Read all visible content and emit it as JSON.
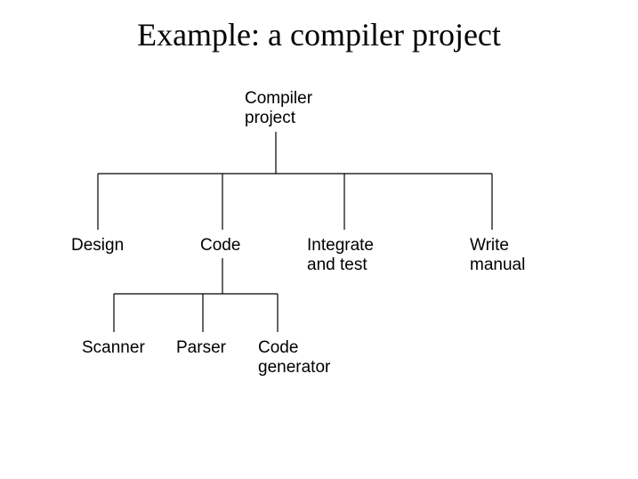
{
  "title": "Example: a compiler project",
  "diagram": {
    "root": {
      "line1": "Compiler",
      "line2": "project"
    },
    "level1": {
      "design": "Design",
      "code": "Code",
      "integrate": {
        "line1": "Integrate",
        "line2": "and test"
      },
      "write": {
        "line1": "Write",
        "line2": "manual"
      }
    },
    "level2": {
      "scanner": "Scanner",
      "parser": "Parser",
      "codegen": {
        "line1": "Code",
        "line2": "generator"
      }
    }
  }
}
